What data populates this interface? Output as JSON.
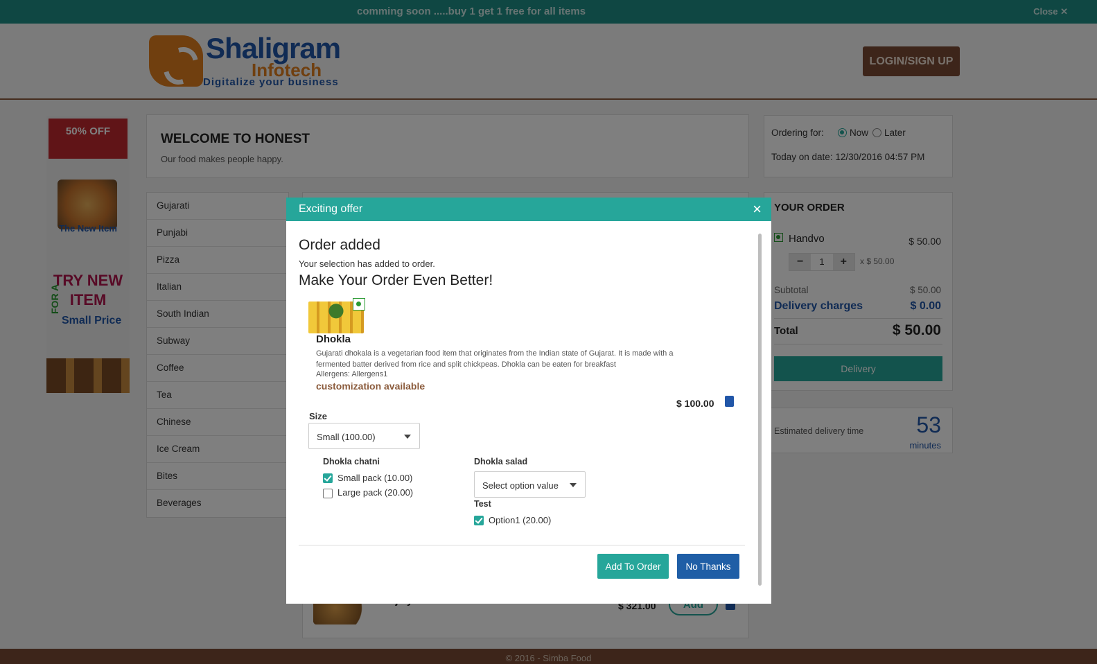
{
  "promo": {
    "text": "comming soon .....buy 1 get 1 free for all items",
    "close": "Close ✕"
  },
  "header": {
    "logo": {
      "name": "Shaligram",
      "sub": "Infotech",
      "tagline": "Digitalize your business"
    },
    "login_label": "LOGIN/SIGN UP"
  },
  "banner": {
    "ribbon": "50% OFF",
    "new_item": "The New Item",
    "try_line": "TRY NEW ITEM",
    "for_a": "FOR A",
    "small_price": "Small Price"
  },
  "welcome": {
    "title": "WELCOME TO HONEST",
    "subtitle": "Our food makes people happy."
  },
  "categories": [
    "Gujarati",
    "Punjabi",
    "Pizza",
    "Italian",
    "South Indian",
    "Subway",
    "Coffee",
    "Tea",
    "Chinese",
    "Ice Cream",
    "Bites",
    "Beverages"
  ],
  "menu_item": {
    "name": "Bhajiay",
    "price": "$ 321.00",
    "add_label": "Add"
  },
  "ordering": {
    "label": "Ordering for:",
    "now": "Now",
    "later": "Later",
    "selected": "Now",
    "date": "Today on date: 12/30/2016 04:57 PM"
  },
  "your_order": {
    "title": "YOUR ORDER",
    "item_name": "Handvo",
    "item_price": "$ 50.00",
    "qty": "1",
    "minus": "−",
    "plus": "+",
    "unit": "x $ 50.00",
    "subtotal_label": "Subtotal",
    "subtotal": "$ 50.00",
    "delivery_label": "Delivery charges",
    "delivery": "$ 0.00",
    "total_label": "Total",
    "total": "$ 50.00",
    "delivery_button": "Delivery"
  },
  "eta": {
    "label": "Estimated delivery time",
    "value": "53",
    "unit": "minutes"
  },
  "footer": {
    "text": "© 2016 - Simba Food"
  },
  "modal": {
    "title": "Exciting offer",
    "close": "×",
    "order_added": "Order added",
    "added_sub": "Your selection has added to order.",
    "better": "Make Your Order Even Better!",
    "item": {
      "name": "Dhokla",
      "description": "Gujarati dhokala is a vegetarian food item that originates from the Indian state of Gujarat. It is made with a fermented batter derived from rice and split chickpeas. Dhokla can be eaten for breakfast",
      "allergens": "Allergens: Allergens1",
      "customization": "customization available",
      "price": "$ 100.00"
    },
    "size": {
      "label": "Size",
      "value": "Small (100.00)"
    },
    "chatni": {
      "label": "Dhokla chatni",
      "options": [
        {
          "label": "Small pack (10.00)",
          "checked": true
        },
        {
          "label": "Large pack (20.00)",
          "checked": false
        }
      ]
    },
    "salad": {
      "label": "Dhokla salad",
      "value": "Select option value"
    },
    "test": {
      "label": "Test",
      "options": [
        {
          "label": "Option1 (20.00)",
          "checked": true
        }
      ]
    },
    "add_label": "Add To Order",
    "no_label": "No Thanks"
  },
  "colors": {
    "teal": "#26a69a",
    "brown": "#7a4b35",
    "blue": "#2156a8"
  }
}
